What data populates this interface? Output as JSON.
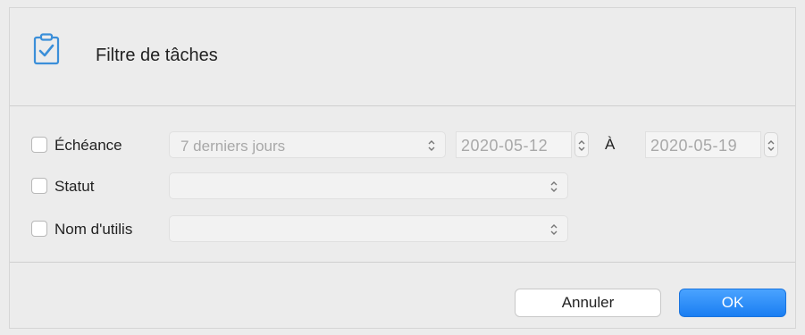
{
  "dialog": {
    "title": "Filtre de tâches",
    "icon": "clipboard-check-icon"
  },
  "rows": [
    {
      "label": "Échéance",
      "checked": false,
      "select_value": "7 derniers jours",
      "date_from": "2020-05-12",
      "to_label": "À",
      "date_to": "2020-05-19"
    },
    {
      "label": "Statut",
      "checked": false,
      "select_value": ""
    },
    {
      "label": "Nom d'utilis",
      "checked": false,
      "select_value": ""
    }
  ],
  "buttons": {
    "cancel_label": "Annuler",
    "ok_label": "OK"
  },
  "colors": {
    "accent": "#1a7ef2",
    "icon": "#3b8fd9"
  }
}
